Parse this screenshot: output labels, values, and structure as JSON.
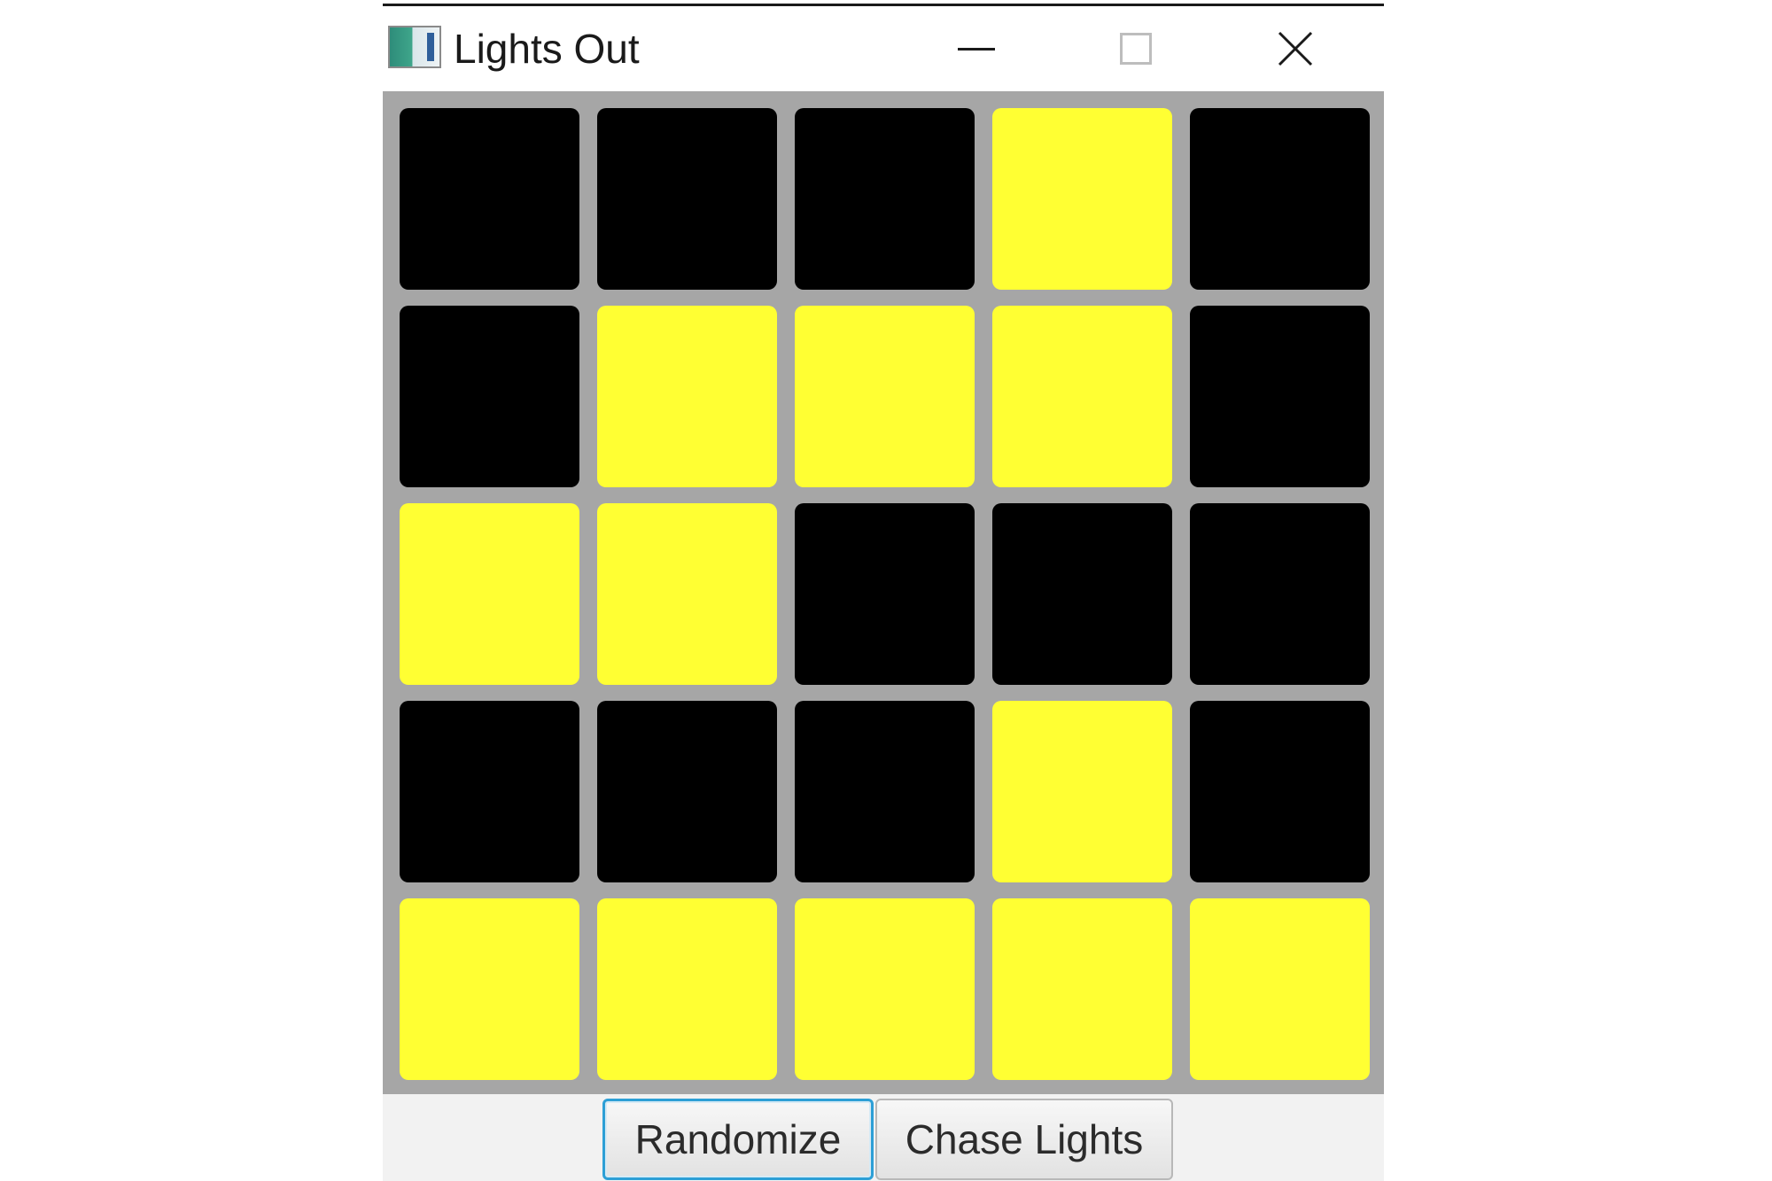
{
  "window": {
    "title": "Lights Out",
    "controls": {
      "minimize_icon": "minimize-icon",
      "maximize_icon": "maximize-icon",
      "close_icon": "close-icon",
      "close_glyph": "✕"
    }
  },
  "board": {
    "rows": 5,
    "cols": 5,
    "cells": [
      [
        0,
        0,
        0,
        1,
        0
      ],
      [
        0,
        1,
        1,
        1,
        0
      ],
      [
        1,
        1,
        0,
        0,
        0
      ],
      [
        0,
        0,
        0,
        1,
        0
      ],
      [
        1,
        1,
        1,
        1,
        1
      ]
    ],
    "colors": {
      "on": "#ffff33",
      "off": "#000000",
      "grid": "#a6a6a6"
    }
  },
  "buttons": {
    "randomize_label": "Randomize",
    "chase_label": "Chase Lights"
  }
}
